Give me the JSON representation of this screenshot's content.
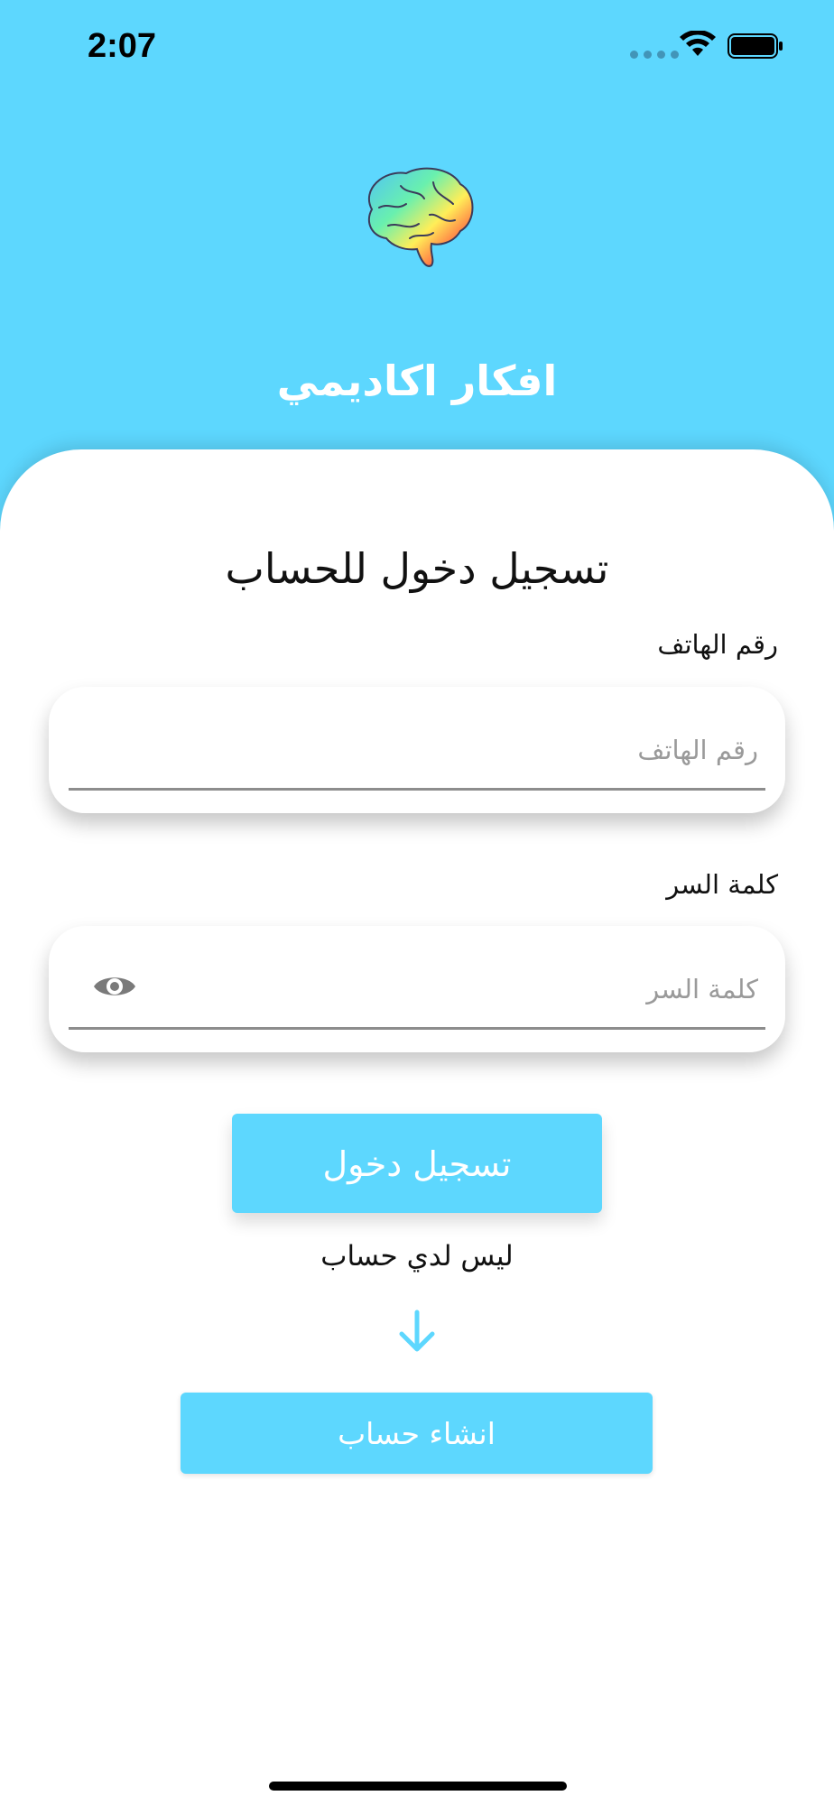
{
  "status_bar": {
    "time": "2:07"
  },
  "app": {
    "title": "افكار اكاديمي",
    "logo_icon": "brain-icon"
  },
  "login": {
    "heading": "تسجيل دخول للحساب",
    "phone": {
      "label": "رقم الهاتف",
      "placeholder": "رقم الهاتف",
      "value": ""
    },
    "password": {
      "label": "كلمة السر",
      "placeholder": "كلمة السر",
      "value": "",
      "toggle_icon": "eye-icon"
    },
    "submit_label": "تسجيل دخول",
    "no_account_text": "ليس لدي حساب",
    "arrow_icon": "arrow-down-icon",
    "create_account_label": "انشاء حساب"
  },
  "colors": {
    "accent": "#5dd7fe",
    "sheet": "#ffffff"
  }
}
